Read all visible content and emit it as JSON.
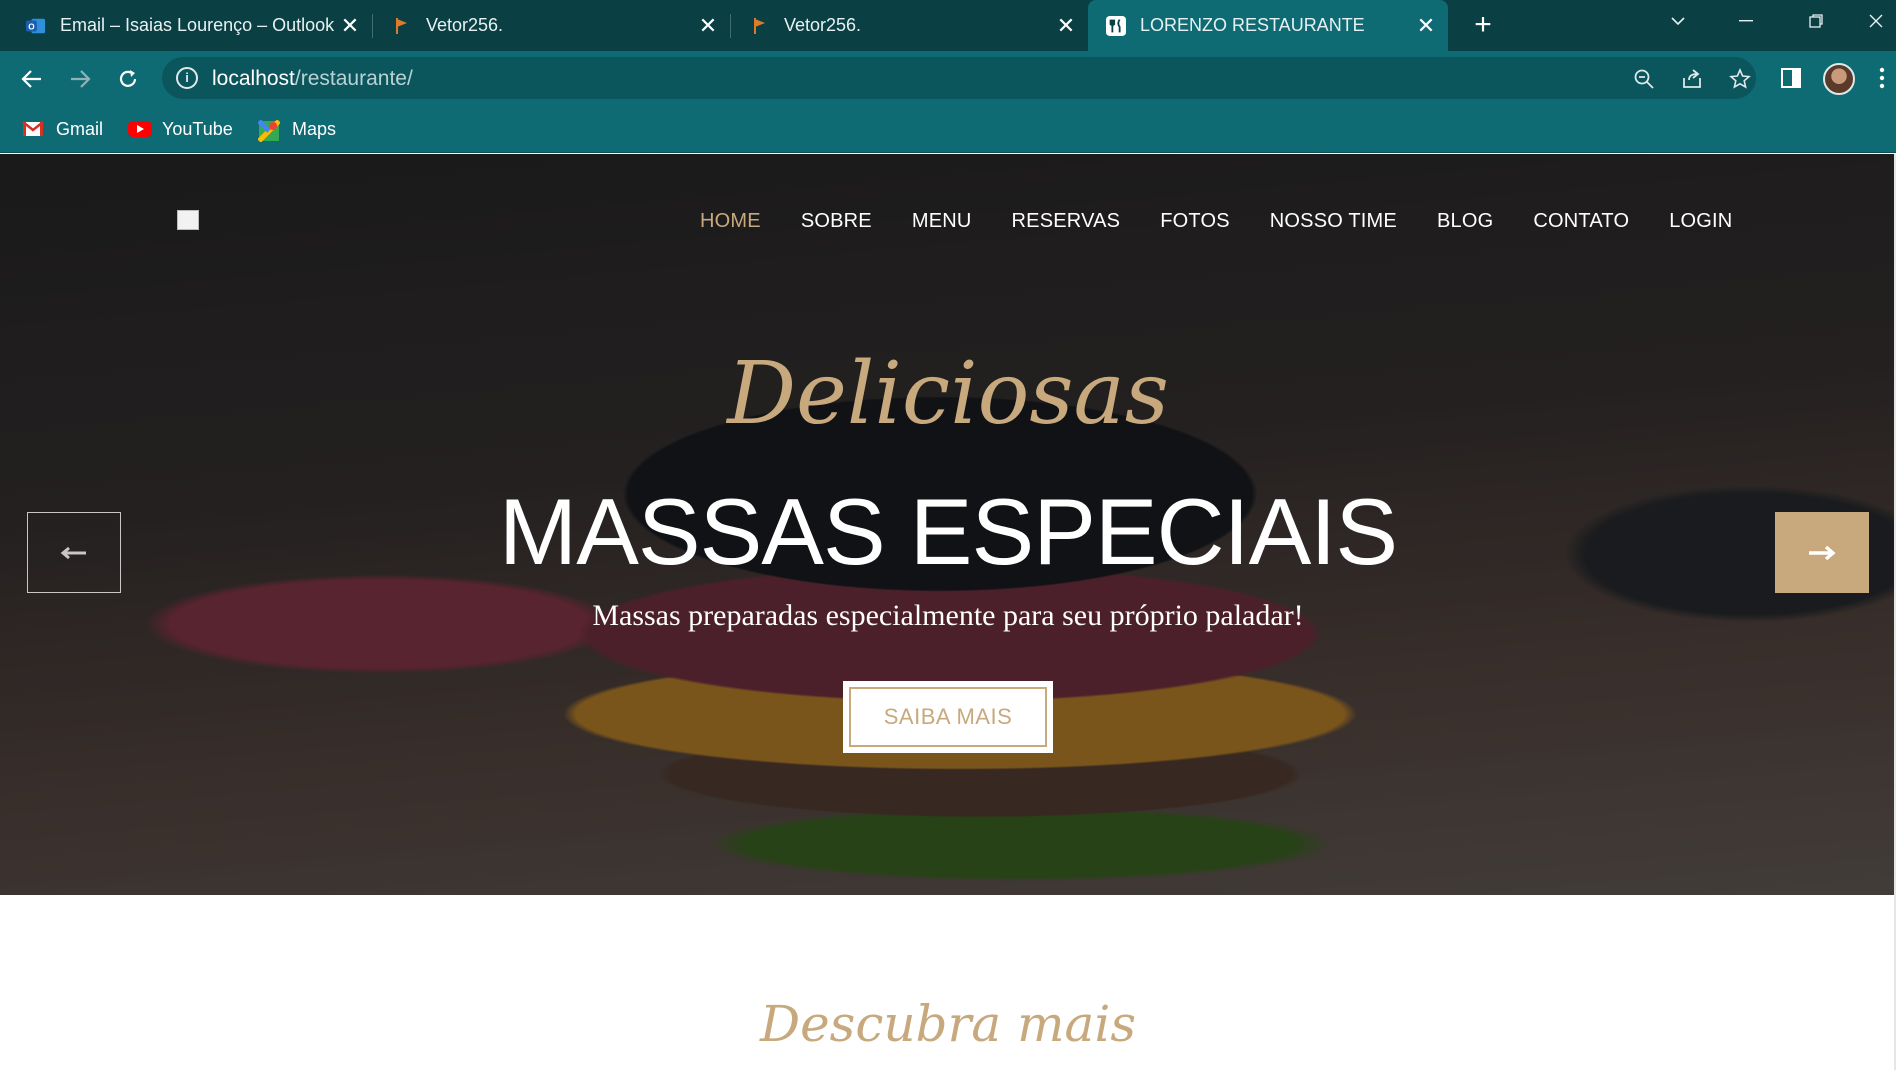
{
  "browser": {
    "tabs": [
      {
        "title": "Email – Isaias Lourenço – Outlook",
        "icon": "outlook-icon",
        "close": "✕"
      },
      {
        "title": "Vetor256.",
        "icon": "flag-icon",
        "close": "✕"
      },
      {
        "title": "Vetor256.",
        "icon": "flag-icon",
        "close": "✕"
      },
      {
        "title": "LORENZO RESTAURANTE",
        "icon": "fork-knife-icon",
        "close": "✕",
        "active": true
      }
    ],
    "new_tab": "+",
    "address": {
      "host": "localhost",
      "path": "/restaurante/"
    },
    "bookmarks": [
      {
        "label": "Gmail",
        "icon": "gmail-icon"
      },
      {
        "label": "YouTube",
        "icon": "youtube-icon"
      },
      {
        "label": "Maps",
        "icon": "maps-icon"
      }
    ]
  },
  "site": {
    "nav": [
      "HOME",
      "SOBRE",
      "MENU",
      "RESERVAS",
      "FOTOS",
      "NOSSO TIME",
      "BLOG",
      "CONTATO",
      "LOGIN"
    ],
    "active_nav": "HOME",
    "hero": {
      "script_title": "Deliciosas",
      "title": "MASSAS ESPECIAIS",
      "subtitle": "Massas preparadas especialmente para seu próprio paladar!",
      "cta": "SAIBA MAIS"
    },
    "section_heading": "Descubra mais"
  },
  "colors": {
    "accent": "#c8a97e",
    "chrome": "#0f6b73",
    "tabbar": "#0a3f44"
  }
}
